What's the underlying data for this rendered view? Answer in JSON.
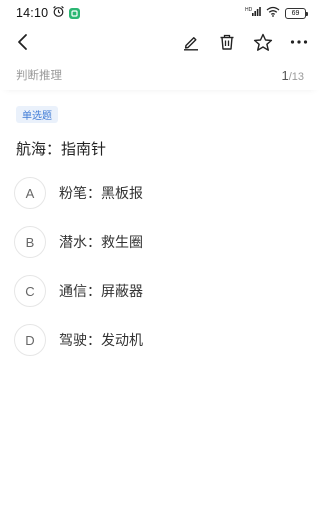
{
  "status_bar": {
    "time": "14:10",
    "battery": "69",
    "icons": [
      "alarm-icon",
      "app-badge-icon",
      "signal-icon",
      "wifi-icon",
      "battery-icon"
    ]
  },
  "toolbar": {
    "icons": [
      "back-icon",
      "edit-icon",
      "delete-icon",
      "star-icon",
      "more-icon"
    ]
  },
  "section": {
    "title": "判断推理",
    "current": "1",
    "total": "/13"
  },
  "question": {
    "type_badge": "单选题",
    "stem": "航海：指南针",
    "options": [
      {
        "letter": "A",
        "text": "粉笔：黑板报"
      },
      {
        "letter": "B",
        "text": "潜水：救生圈"
      },
      {
        "letter": "C",
        "text": "通信：屏蔽器"
      },
      {
        "letter": "D",
        "text": "驾驶：发动机"
      }
    ]
  },
  "colors": {
    "accent": "#3f7bd6",
    "badge_bg": "#eaf1fb",
    "muted": "#9a9a9a"
  }
}
